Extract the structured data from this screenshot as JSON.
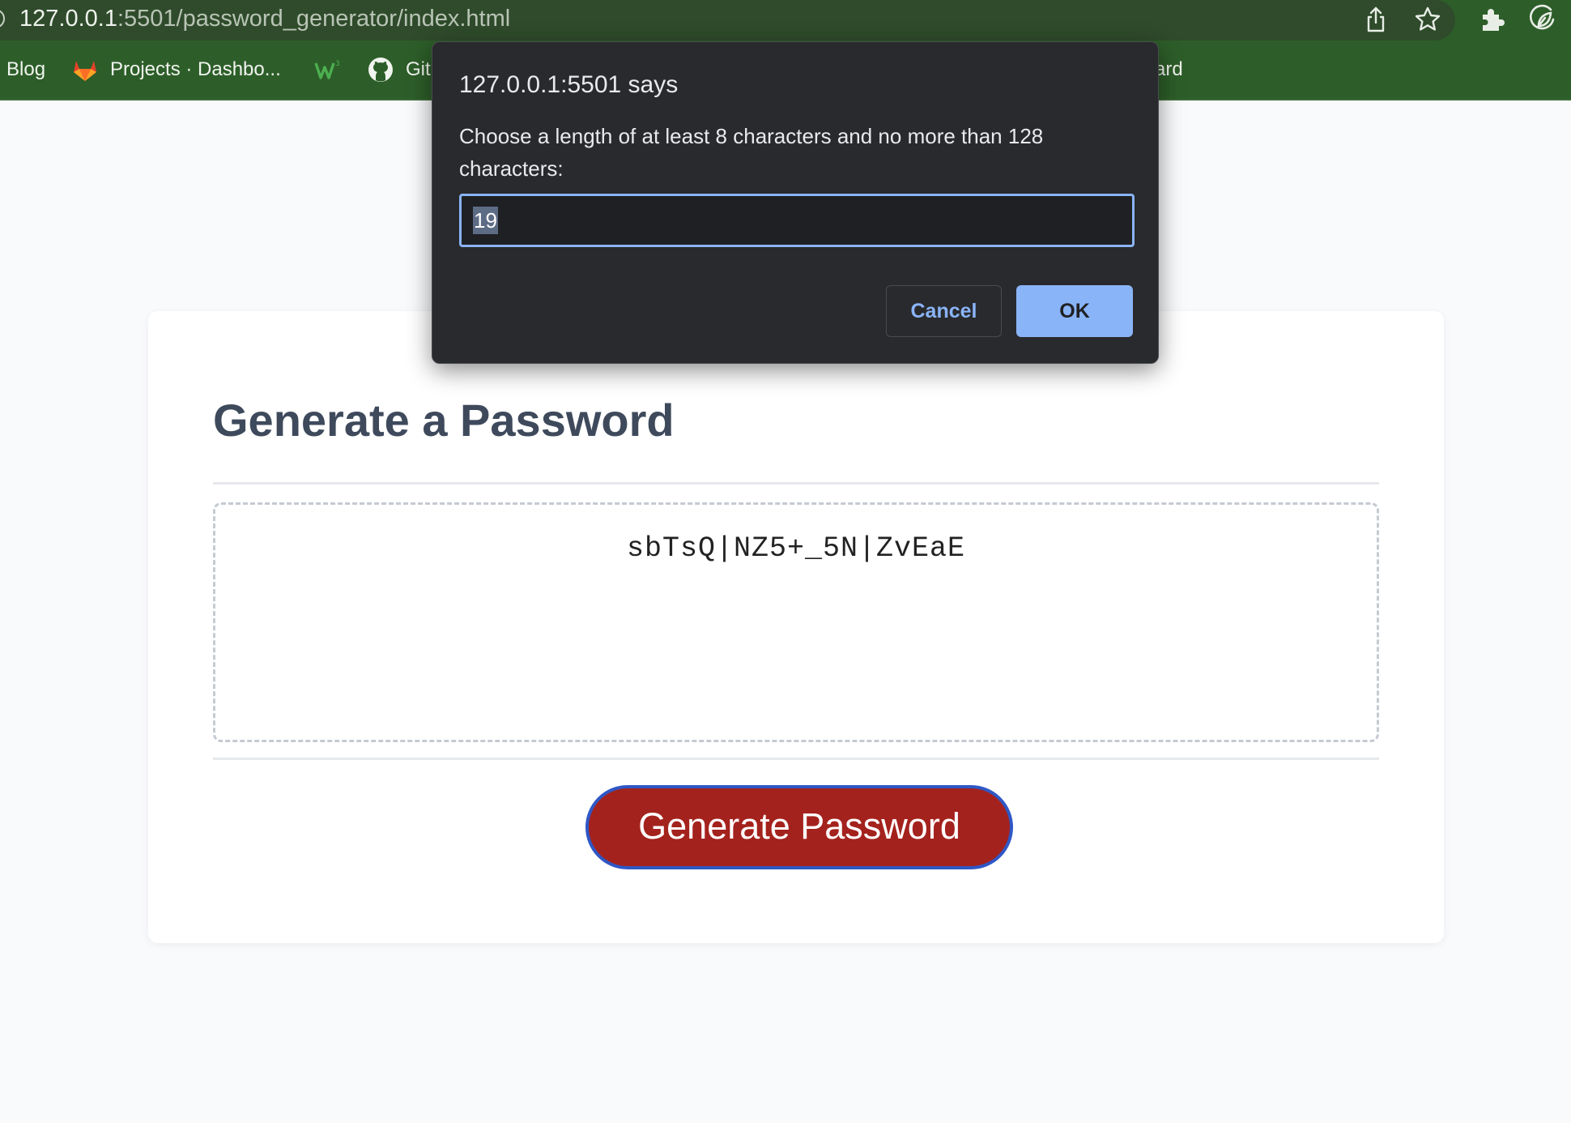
{
  "browser": {
    "url_host": "127.0.0.1",
    "url_path": ":5501/password_generator/index.html",
    "theme_color": "#2d5e29",
    "toolbar_icons": [
      "share-icon",
      "star-icon",
      "extensions-icon",
      "leaf-extension-icon"
    ],
    "bookmarks": [
      {
        "label": "Blog",
        "icon": null
      },
      {
        "label": "Projects · Dashbo...",
        "icon": "gitlab-icon"
      },
      {
        "label": "",
        "icon": "w3schools-icon"
      },
      {
        "label": "Git",
        "icon": "github-icon"
      },
      {
        "label": "ard",
        "icon": null
      }
    ]
  },
  "page": {
    "title": "Generate a Password",
    "password": "sbTsQ|NZ5+_5N|ZvEaE",
    "generate_button": "Generate Password",
    "button_color": "#a4221d"
  },
  "dialog": {
    "title": "127.0.0.1:5501 says",
    "message": "Choose a length of at least 8 characters and no more than 128 characters:",
    "input_value": "19",
    "cancel_label": "Cancel",
    "ok_label": "OK",
    "accent_color": "#8ab4f8"
  }
}
